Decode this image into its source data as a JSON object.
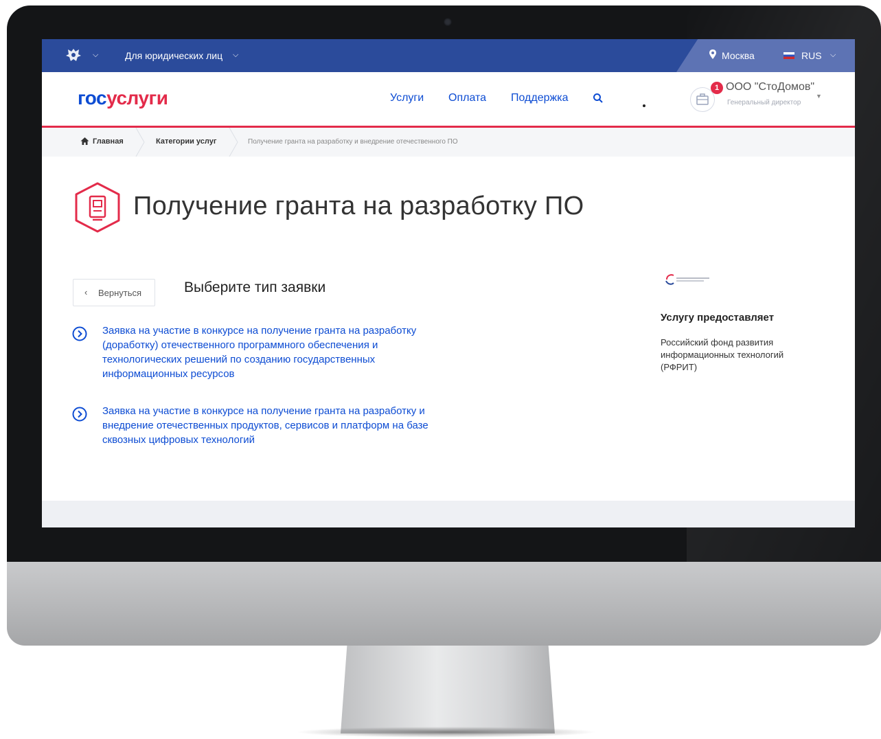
{
  "topbar": {
    "legal_menu_label": "Для юридических лиц",
    "city": "Москва",
    "language": "RUS"
  },
  "header": {
    "logo_part1": "гос",
    "logo_part2": "услуги",
    "nav": [
      "Услуги",
      "Оплата",
      "Поддержка"
    ],
    "notification_count": "1",
    "org_name": "ООО \"СтоДомов\"",
    "org_role": "Генеральный директор"
  },
  "breadcrumbs": [
    "Главная",
    "Категории услуг",
    "Получение гранта на разработку и внедрение отечественного ПО"
  ],
  "main": {
    "title": "Получение гранта на разработку ПО",
    "back_label": "Вернуться",
    "section_title": "Выберите тип заявки",
    "options": [
      "Заявка на участие в конкурсе на получение гранта на разработку (доработку) отечественного программного обеспечения и технологических решений по созданию государственных информационных ресурсов",
      "Заявка на участие в конкурсе на получение гранта на разработку и внедрение отечественных продуктов, сервисов и платформ на базе сквозных цифровых технологий"
    ]
  },
  "sidebar": {
    "provider_title": "Услугу предоставляет",
    "provider_name": "Российский фонд развития информационных технологий (РФРИТ)"
  },
  "colors": {
    "topbar": "#2b4b9b",
    "link": "#0d4cd3",
    "accent_red": "#e32b4a"
  }
}
